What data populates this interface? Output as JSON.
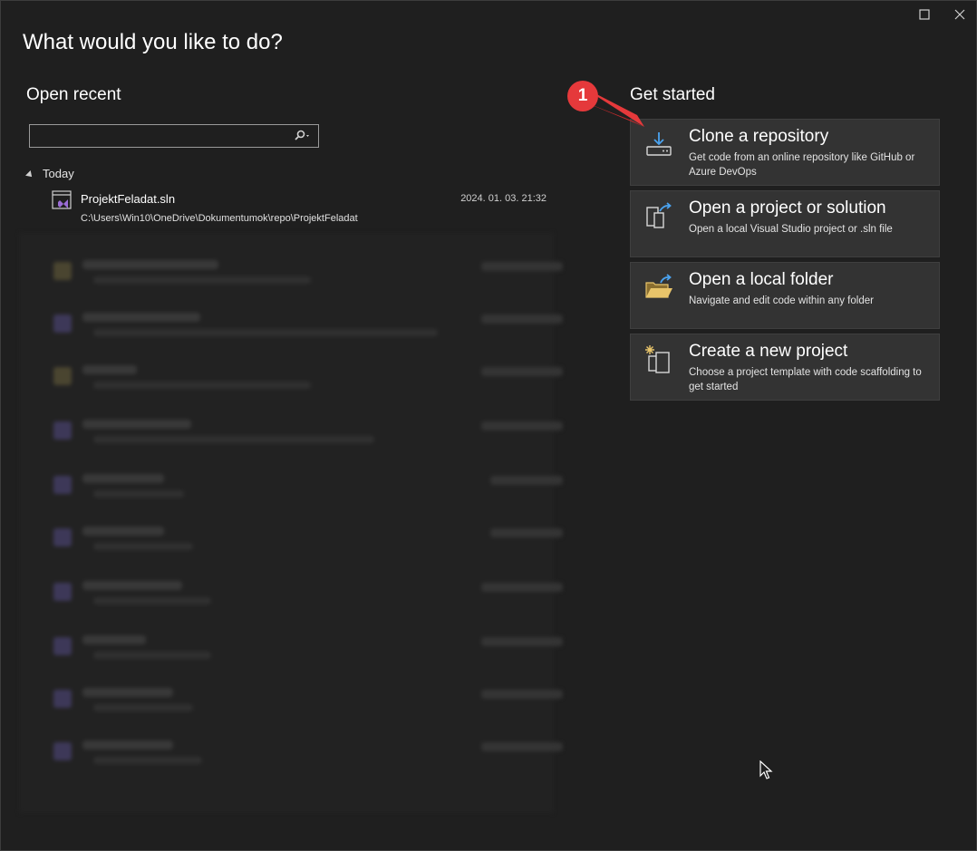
{
  "window": {
    "title": "What would you like to do?"
  },
  "recent": {
    "heading": "Open recent",
    "search": {
      "placeholder": "",
      "value": ""
    },
    "group_label": "Today",
    "items": [
      {
        "name": "ProjektFeladat.sln",
        "path": "C:\\Users\\Win10\\OneDrive\\Dokumentumok\\repo\\ProjektFeladat",
        "date": "2024. 01. 03. 21:32"
      }
    ]
  },
  "get_started": {
    "heading": "Get started",
    "cards": [
      {
        "title": "Clone a repository",
        "desc": "Get code from an online repository like GitHub or Azure DevOps",
        "icon": "clone-download-icon"
      },
      {
        "title": "Open a project or solution",
        "desc": "Open a local Visual Studio project or .sln file",
        "icon": "open-project-icon"
      },
      {
        "title": "Open a local folder",
        "desc": "Navigate and edit code within any folder",
        "icon": "open-folder-icon"
      },
      {
        "title": "Create a new project",
        "desc": "Choose a project template with code scaffolding to get started",
        "icon": "new-project-icon"
      }
    ]
  },
  "annotation": {
    "badge": "1"
  },
  "colors": {
    "background": "#1f1f1f",
    "card": "#333333",
    "accent_blue": "#4aa3f0",
    "badge_red": "#e5393b",
    "vs_purple": "#9b6dd6",
    "folder_yellow": "#e8c46a"
  }
}
